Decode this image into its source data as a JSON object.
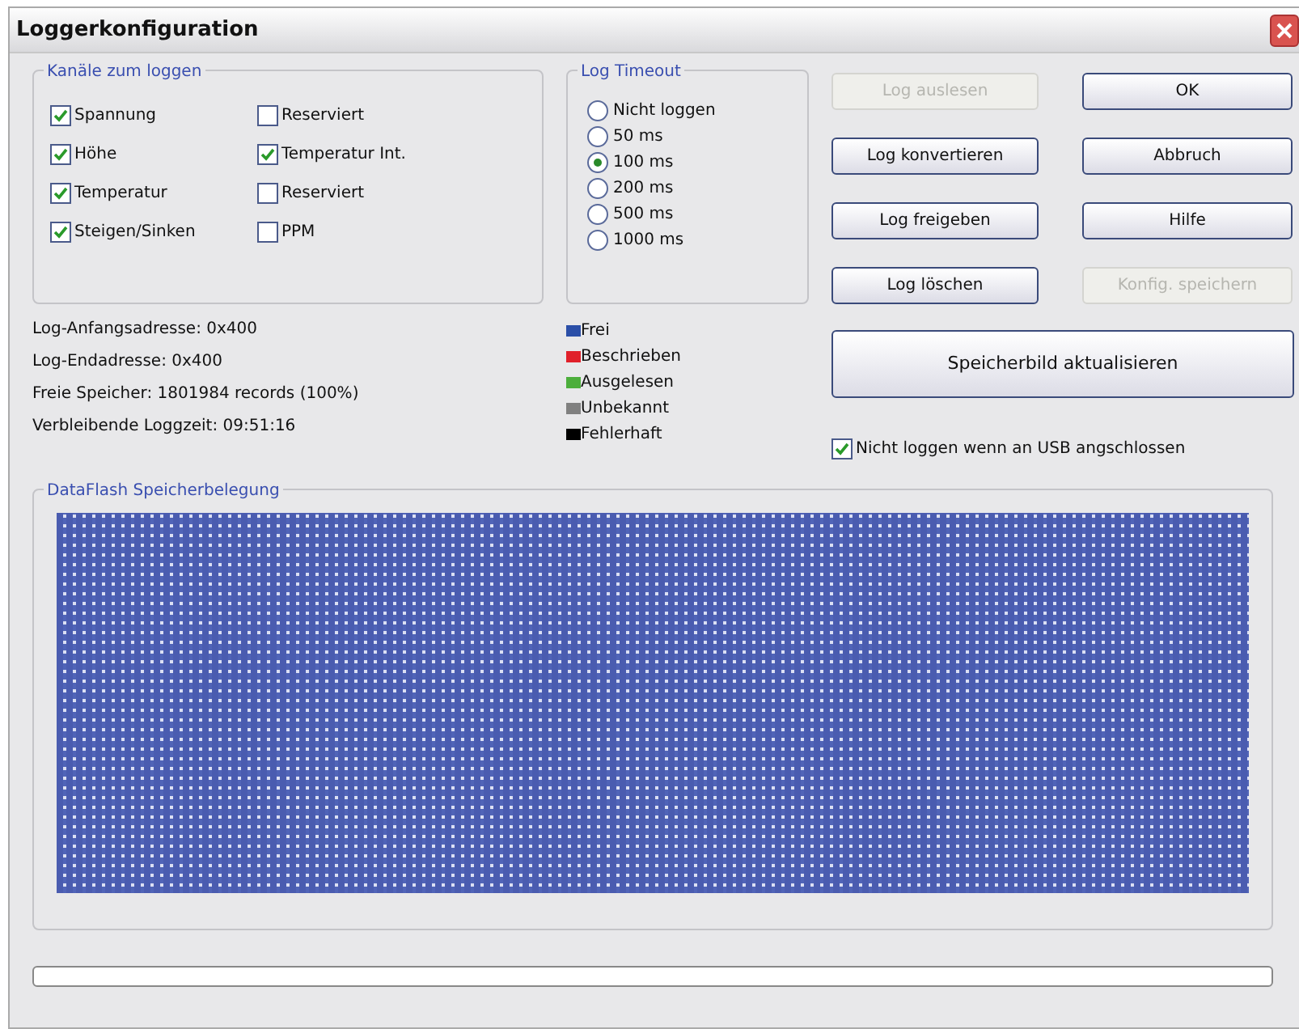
{
  "window": {
    "title": "Loggerkonfiguration"
  },
  "channels": {
    "title": "Kanäle zum loggen",
    "items": [
      {
        "label": "Spannung",
        "checked": true
      },
      {
        "label": "Reserviert",
        "checked": false
      },
      {
        "label": "Höhe",
        "checked": true
      },
      {
        "label": "Temperatur Int.",
        "checked": true
      },
      {
        "label": "Temperatur",
        "checked": true
      },
      {
        "label": "Reserviert",
        "checked": false
      },
      {
        "label": "Steigen/Sinken",
        "checked": true
      },
      {
        "label": "PPM",
        "checked": false
      }
    ]
  },
  "log_timeout": {
    "title": "Log Timeout",
    "options": [
      {
        "label": "Nicht loggen",
        "selected": false
      },
      {
        "label": "50 ms",
        "selected": false
      },
      {
        "label": "100 ms",
        "selected": true
      },
      {
        "label": "200 ms",
        "selected": false
      },
      {
        "label": "500 ms",
        "selected": false
      },
      {
        "label": "1000 ms",
        "selected": false
      }
    ]
  },
  "buttons": [
    {
      "label": "Log auslesen",
      "disabled": true
    },
    {
      "label": "OK",
      "disabled": false
    },
    {
      "label": "Log konvertieren",
      "disabled": false
    },
    {
      "label": "Abbruch",
      "disabled": false
    },
    {
      "label": "Log freigeben",
      "disabled": false
    },
    {
      "label": "Hilfe",
      "disabled": false
    },
    {
      "label": "Log löschen",
      "disabled": false
    },
    {
      "label": "Konfig. speichern",
      "disabled": true
    }
  ],
  "info": [
    "Log-Anfangsadresse: 0x400",
    "Log-Endadresse: 0x400",
    "Freie Speicher: 1801984 records (100%)",
    "Verbleibende Loggzeit: 09:51:16"
  ],
  "legend": [
    {
      "label": "Frei",
      "color": "#2b4fa8"
    },
    {
      "label": "Beschrieben",
      "color": "#e0202a"
    },
    {
      "label": "Ausgelesen",
      "color": "#4cae3c"
    },
    {
      "label": "Unbekannt",
      "color": "#808080"
    },
    {
      "label": "Fehlerhaft",
      "color": "#000000"
    }
  ],
  "refresh_button": {
    "label": "Speicherbild aktualisieren"
  },
  "usb_option": {
    "label": "Nicht loggen wenn an USB angschlossen",
    "checked": true
  },
  "memory_map": {
    "title": "DataFlash Speicherbelegung"
  },
  "progress": {
    "level": 0
  }
}
